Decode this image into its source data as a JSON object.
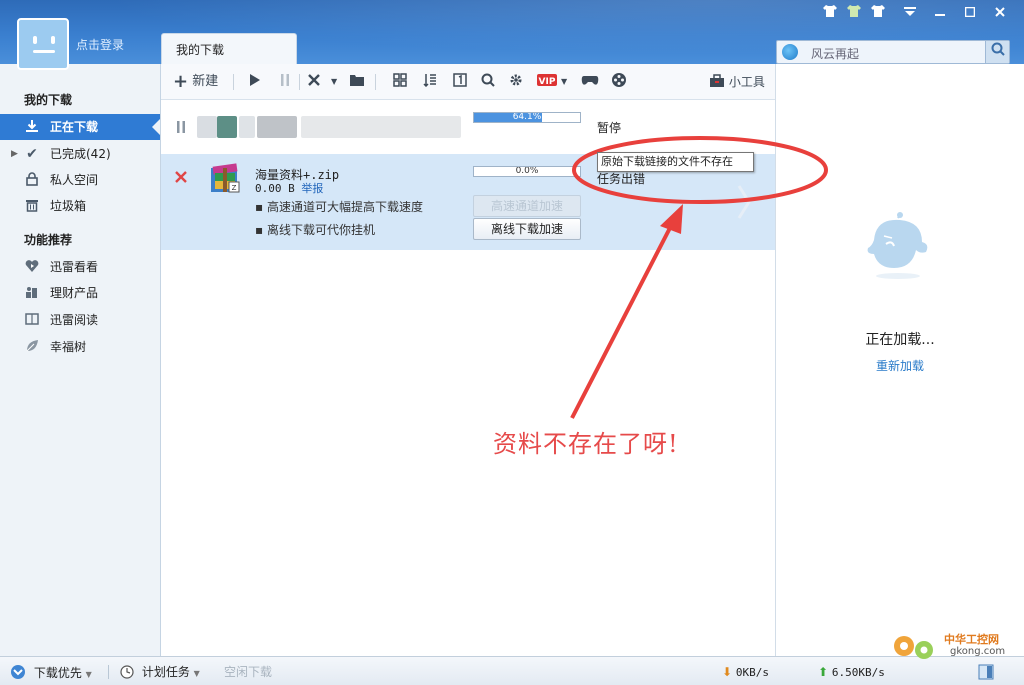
{
  "window": {
    "login_text": "点击登录",
    "tab_label": "我的下载",
    "controls": [
      "skin-1",
      "skin-2",
      "skin-3",
      "menu",
      "minimize",
      "maximize",
      "close"
    ]
  },
  "search": {
    "placeholder": "风云再起"
  },
  "sidebar": {
    "section1": "我的下载",
    "items": [
      {
        "label": "正在下载",
        "icon": "download-icon",
        "active": true
      },
      {
        "label": "已完成(42)",
        "icon": "check-icon",
        "active": false
      },
      {
        "label": "私人空间",
        "icon": "lock-icon",
        "active": false
      },
      {
        "label": "垃圾箱",
        "icon": "trash-icon",
        "active": false
      }
    ],
    "section2": "功能推荐",
    "features": [
      {
        "label": "迅雷看看",
        "icon": "play-heart-icon"
      },
      {
        "label": "理财产品",
        "icon": "finance-icon"
      },
      {
        "label": "迅雷阅读",
        "icon": "book-icon"
      },
      {
        "label": "幸福树",
        "icon": "leaf-icon"
      }
    ]
  },
  "toolbar": {
    "new_label": "新建",
    "tools_label": "小工具"
  },
  "tasks": [
    {
      "progress_text": "64.1%",
      "progress": 0.641,
      "status": "暂停"
    },
    {
      "filename": "海量资料+.zip",
      "size": "0.00 B",
      "report": "举报",
      "progress_text": "0.0%",
      "progress": 0.0,
      "tip1": "高速通道可大幅提高下载速度",
      "tip2": "离线下载可代你挂机",
      "btn_highspeed": "高速通道加速",
      "btn_offline": "离线下载加速",
      "error_status": "任务出错",
      "tooltip": "原始下载链接的文件不存在"
    }
  ],
  "right_panel": {
    "loading": "正在加载...",
    "reload": "重新加载"
  },
  "statusbar": {
    "priority": "下载优先",
    "scheduled": "计划任务",
    "idle": "空闲下载",
    "down_speed": "0KB/s",
    "up_speed": "6.50KB/s"
  },
  "annotation": "资料不存在了呀!",
  "watermark": {
    "cn": "中华工控网",
    "url": "gkong.com"
  },
  "colors": {
    "accent": "#2f7bd4",
    "annotation": "#e64a4a"
  }
}
